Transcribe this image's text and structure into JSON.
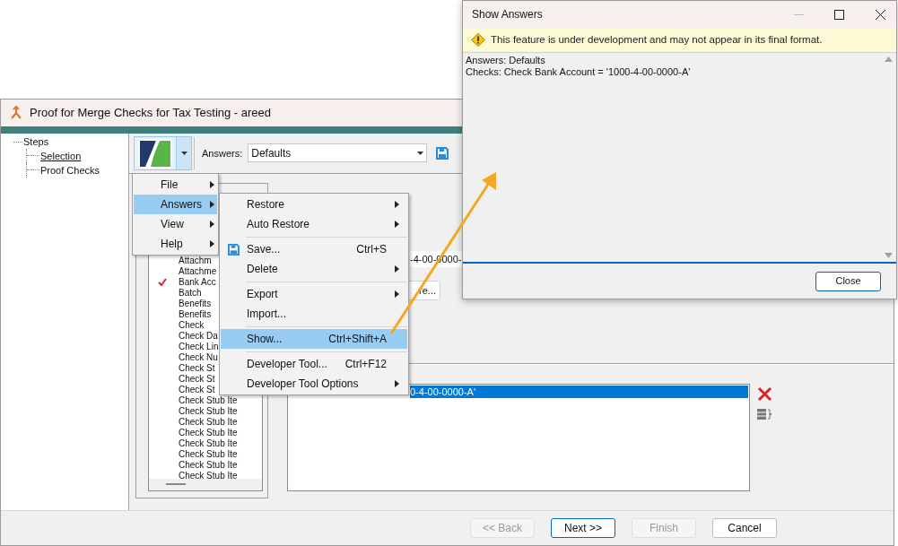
{
  "main_window": {
    "title": "Proof for Merge Checks for Tax Testing - areed",
    "steps": {
      "label": "Steps",
      "children": [
        {
          "label": "Selection",
          "selected": true
        },
        {
          "label": "Proof Checks",
          "selected": false
        }
      ]
    },
    "toolbar": {
      "answers_label": "Answers:",
      "answers_value": "Defaults"
    },
    "fields": [
      {
        "text": "Attachm",
        "checked": false
      },
      {
        "text": "Attachme",
        "checked": false
      },
      {
        "text": "Bank Acc",
        "checked": true
      },
      {
        "text": "Batch",
        "checked": false
      },
      {
        "text": "Benefits",
        "checked": false
      },
      {
        "text": "Benefits",
        "checked": false
      },
      {
        "text": "Check",
        "checked": false
      },
      {
        "text": "Check Da",
        "checked": false
      },
      {
        "text": "Check Lin",
        "checked": false
      },
      {
        "text": "Check Nu",
        "checked": false
      },
      {
        "text": "Check St",
        "checked": false
      },
      {
        "text": "Check St",
        "checked": false
      },
      {
        "text": "Check St",
        "checked": false
      },
      {
        "text": "Check Stub Ite",
        "checked": false
      },
      {
        "text": "Check Stub Ite",
        "checked": false
      },
      {
        "text": "Check Stub Ite",
        "checked": false
      },
      {
        "text": "Check Stub Ite",
        "checked": false
      },
      {
        "text": "Check Stub Ite",
        "checked": false
      },
      {
        "text": "Check Stub Ite",
        "checked": false
      },
      {
        "text": "Check Stub Ite",
        "checked": false
      },
      {
        "text": "Check Stub Ite",
        "checked": false
      }
    ],
    "value_field": "-4-00-0000-",
    "browse_button": "re...",
    "conditions": [
      {
        "text": "0-4-00-0000-A'",
        "selected": true
      }
    ],
    "buttons": [
      {
        "label": "<< Back",
        "disabled": true,
        "default": false
      },
      {
        "label": "Next >>",
        "disabled": false,
        "default": true
      },
      {
        "label": "Finish",
        "disabled": true,
        "default": false
      },
      {
        "label": "Cancel",
        "disabled": false,
        "default": false
      }
    ]
  },
  "menu": {
    "items": [
      {
        "label": "File",
        "selected": false
      },
      {
        "label": "Answers",
        "selected": true
      },
      {
        "label": "View",
        "selected": false
      },
      {
        "label": "Help",
        "selected": false
      }
    ]
  },
  "submenu": {
    "items": [
      {
        "kind": "item",
        "label": "Restore",
        "has_submenu": true,
        "selected": false
      },
      {
        "kind": "item",
        "label": "Auto Restore",
        "has_submenu": true,
        "selected": false
      },
      {
        "kind": "separator"
      },
      {
        "kind": "item",
        "label": "Save...",
        "shortcut": "Ctrl+S",
        "icon": true,
        "selected": false
      },
      {
        "kind": "item",
        "label": "Delete",
        "has_submenu": true,
        "selected": false
      },
      {
        "kind": "separator"
      },
      {
        "kind": "item",
        "label": "Export",
        "has_submenu": true,
        "selected": false
      },
      {
        "kind": "item",
        "label": "Import...",
        "selected": false
      },
      {
        "kind": "separator"
      },
      {
        "kind": "item",
        "label": "Show...",
        "shortcut": "Ctrl+Shift+A",
        "selected": true
      },
      {
        "kind": "separator"
      },
      {
        "kind": "item",
        "label": "Developer Tool...",
        "shortcut": "Ctrl+F12",
        "selected": false
      },
      {
        "kind": "item",
        "label": "Developer Tool Options",
        "has_submenu": true,
        "selected": false
      }
    ]
  },
  "dialog": {
    "title": "Show Answers",
    "warning": "This feature is under development and may not appear in its final format.",
    "lines": [
      "Answers: Defaults",
      "Checks: Check Bank Account = '1000-4-00-0000-A'"
    ],
    "buttons": [
      {
        "label": "Close",
        "default": true
      }
    ]
  }
}
